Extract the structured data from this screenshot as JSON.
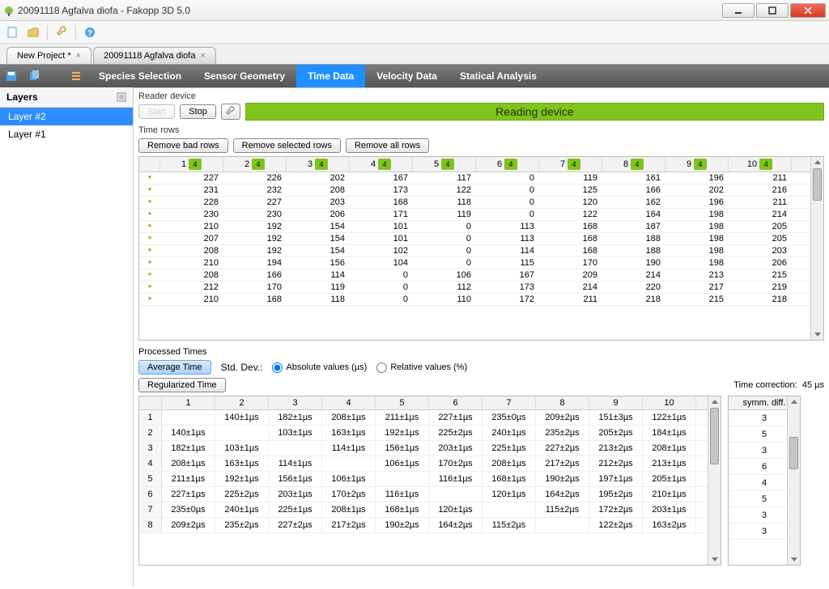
{
  "window": {
    "title": "20091118 Agfalva diofa - Fakopp 3D 5.0"
  },
  "project_tabs": [
    {
      "label": "New Project *",
      "active": false
    },
    {
      "label": "20091118 Agfalva diofa",
      "active": true
    }
  ],
  "ribbon": {
    "items": [
      "Species Selection",
      "Sensor Geometry",
      "Time Data",
      "Velocity Data",
      "Statical Analysis"
    ],
    "active_index": 2
  },
  "sidebar": {
    "header": "Layers",
    "items": [
      "Layer #2",
      "Layer #1"
    ],
    "selected_index": 0
  },
  "reader_device": {
    "group_label": "Reader device",
    "start_label": "Start",
    "stop_label": "Stop",
    "banner": "Reading device"
  },
  "time_rows": {
    "group_label": "Time rows",
    "remove_bad": "Remove bad rows",
    "remove_selected": "Remove selected rows",
    "remove_all": "Remove all rows",
    "col_numbers": [
      "1",
      "2",
      "3",
      "4",
      "5",
      "6",
      "7",
      "8",
      "9",
      "10"
    ],
    "badge": "4",
    "rows": [
      [
        227,
        226,
        202,
        167,
        117,
        0,
        119,
        161,
        196,
        211
      ],
      [
        231,
        232,
        208,
        173,
        122,
        0,
        125,
        166,
        202,
        216
      ],
      [
        228,
        227,
        203,
        168,
        118,
        0,
        120,
        162,
        196,
        211
      ],
      [
        230,
        230,
        206,
        171,
        119,
        0,
        122,
        164,
        198,
        214
      ],
      [
        210,
        192,
        154,
        101,
        0,
        113,
        168,
        187,
        198,
        205
      ],
      [
        207,
        192,
        154,
        101,
        0,
        113,
        168,
        188,
        198,
        205
      ],
      [
        208,
        192,
        154,
        102,
        0,
        114,
        168,
        188,
        198,
        203
      ],
      [
        210,
        194,
        156,
        104,
        0,
        115,
        170,
        190,
        198,
        206
      ],
      [
        208,
        166,
        114,
        0,
        106,
        167,
        209,
        214,
        213,
        215
      ],
      [
        212,
        170,
        119,
        0,
        112,
        173,
        214,
        220,
        217,
        219
      ],
      [
        210,
        168,
        118,
        0,
        110,
        172,
        211,
        218,
        215,
        218
      ]
    ]
  },
  "processed": {
    "group_label": "Processed Times",
    "avg_btn": "Average Time",
    "reg_btn": "Regularized Time",
    "stddev_label": "Std. Dev.:",
    "abs_label": "Absolute values (µs)",
    "rel_label": "Relative values (%)",
    "time_corr_label": "Time correction:",
    "time_corr_value": "45 µs",
    "matrix_cols": [
      "1",
      "2",
      "3",
      "4",
      "5",
      "6",
      "7",
      "8",
      "9",
      "10"
    ],
    "matrix": [
      [
        "",
        "140±1µs",
        "182±1µs",
        "208±1µs",
        "211±1µs",
        "227±1µs",
        "235±0µs",
        "209±2µs",
        "151±3µs",
        "122±1µs"
      ],
      [
        "140±1µs",
        "",
        "103±1µs",
        "163±1µs",
        "192±1µs",
        "225±2µs",
        "240±1µs",
        "235±2µs",
        "205±2µs",
        "184±1µs"
      ],
      [
        "182±1µs",
        "103±1µs",
        "",
        "114±1µs",
        "156±1µs",
        "203±1µs",
        "225±1µs",
        "227±2µs",
        "213±2µs",
        "208±1µs"
      ],
      [
        "208±1µs",
        "163±1µs",
        "114±1µs",
        "",
        "106±1µs",
        "170±2µs",
        "208±1µs",
        "217±2µs",
        "212±2µs",
        "213±1µs"
      ],
      [
        "211±1µs",
        "192±1µs",
        "156±1µs",
        "106±1µs",
        "",
        "116±1µs",
        "168±1µs",
        "190±2µs",
        "197±1µs",
        "205±1µs"
      ],
      [
        "227±1µs",
        "225±2µs",
        "203±1µs",
        "170±2µs",
        "116±1µs",
        "",
        "120±1µs",
        "164±2µs",
        "195±2µs",
        "210±1µs"
      ],
      [
        "235±0µs",
        "240±1µs",
        "225±1µs",
        "208±1µs",
        "168±1µs",
        "120±1µs",
        "",
        "115±2µs",
        "172±2µs",
        "203±1µs"
      ],
      [
        "209±2µs",
        "235±2µs",
        "227±2µs",
        "217±2µs",
        "190±2µs",
        "164±2µs",
        "115±2µs",
        "",
        "122±2µs",
        "163±2µs"
      ]
    ],
    "symm_header": "symm. diff.",
    "symm": [
      "3",
      "5",
      "3",
      "6",
      "4",
      "5",
      "3",
      "3"
    ]
  }
}
